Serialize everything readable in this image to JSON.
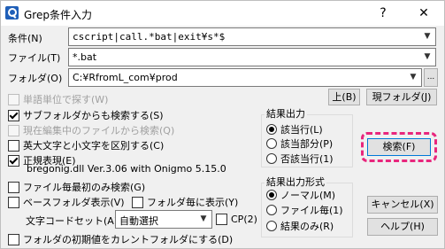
{
  "window": {
    "title": "Grep条件入力",
    "help": "?",
    "close": "✕"
  },
  "fields": {
    "condition": {
      "label": "条件(N)",
      "value": "cscript|call.*bat|exit¥s*$"
    },
    "file": {
      "label": "ファイル(T)",
      "value": "*.bat"
    },
    "folder": {
      "label": "フォルダ(O)",
      "value": "C:¥RfromL_com¥prod"
    }
  },
  "buttons": {
    "browse": "...",
    "up": "上(B)",
    "current_folder": "現フォルダ(J)",
    "search": "検索(F)",
    "cancel": "キャンセル(X)",
    "help": "ヘルプ(H)"
  },
  "checkboxes": {
    "word_unit": "単語単位で探す(W)",
    "subfolders": "サブフォルダからも検索する(S)",
    "current_file": "現在編集中のファイルから検索(Q)",
    "case": "英大文字と小文字を区別する(C)",
    "regex": "正規表現(E)",
    "first_only": "ファイル毎最初のみ検索(G)",
    "base_folder": "ベースフォルダ表示(V)",
    "per_folder": "フォルダ毎に表示(Y)",
    "cp": "CP(2)",
    "init_folder": "フォルダの初期値をカレントフォルダにする(D)"
  },
  "regex_version": "bregonig.dll Ver.3.06 with Onigmo 5.15.0",
  "encoding": {
    "label": "文字コードセット(A)",
    "value": "自動選択"
  },
  "result_output": {
    "title": "結果出力",
    "options": [
      "該当行(L)",
      "該当部分(P)",
      "否該当行(1)"
    ]
  },
  "result_format": {
    "title": "結果出力形式",
    "options": [
      "ノーマル(M)",
      "ファイル毎(1)",
      "結果のみ(R)"
    ]
  },
  "state": {
    "subfolders": true,
    "regex": true,
    "word_unit": false,
    "current_file": false,
    "case": false,
    "first_only": false,
    "base_folder": false,
    "per_folder": false,
    "cp": false,
    "init_folder": false,
    "result_output_selected": 0,
    "result_format_selected": 0
  },
  "colors": {
    "focus_ring": "#e8267d",
    "title_bg": "#ffffff",
    "dialog_bg": "#f0f0f0"
  }
}
